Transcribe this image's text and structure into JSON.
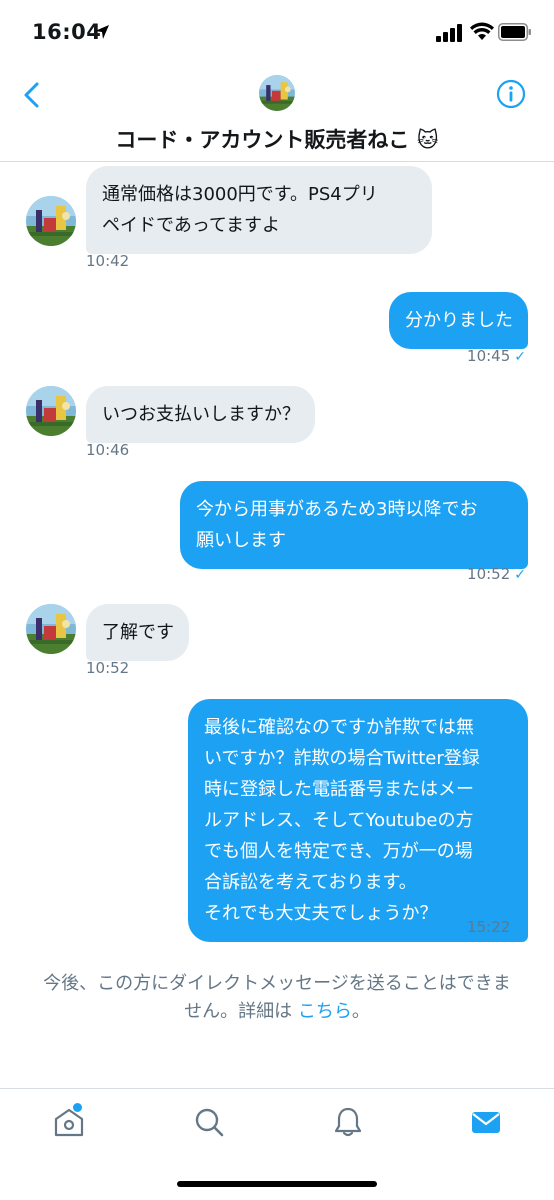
{
  "status_bar": {
    "time": "16:04"
  },
  "header": {
    "title": "コード・アカウント販売者ねこ 🐱"
  },
  "colors": {
    "accent": "#1da1f2",
    "incoming_bubble": "#e6ecf0",
    "muted_text": "#657786"
  },
  "messages": [
    {
      "direction": "in",
      "text": "通常価格は3000円です。PS4プリ\nペイドであってますよ",
      "time": "10:42"
    },
    {
      "direction": "out",
      "text": "分かりました",
      "time": "10:45"
    },
    {
      "direction": "in",
      "text": "いつお支払いしますか？",
      "time": "10:46"
    },
    {
      "direction": "out",
      "text": "今から用事があるため3時以降でお\n願いします",
      "time": "10:52"
    },
    {
      "direction": "in",
      "text": "了解です",
      "time": "10:52"
    },
    {
      "direction": "out",
      "text": "最後に確認なのですか詐欺では無\nいですか？詐欺の場合Twitter登録\n時に登録した電話番号またはメー\nルアドレス、そしてYoutubeの方\nでも個人を特定でき、万が一の場\n合訴訟を考えております。\nそれでも大丈夫でしょうか？",
      "time": "15:22"
    }
  ],
  "read_mark": "✓",
  "notice": {
    "text": "今後、この方にダイレクトメッセージを送ることはできま\nせん。詳細は ",
    "link": "こちら",
    "suffix": "。"
  },
  "tabs": [
    {
      "name": "home",
      "icon": "home-icon",
      "has_notification": true
    },
    {
      "name": "search",
      "icon": "search-icon"
    },
    {
      "name": "notifications",
      "icon": "bell-icon"
    },
    {
      "name": "messages",
      "icon": "mail-icon",
      "active": true
    }
  ]
}
